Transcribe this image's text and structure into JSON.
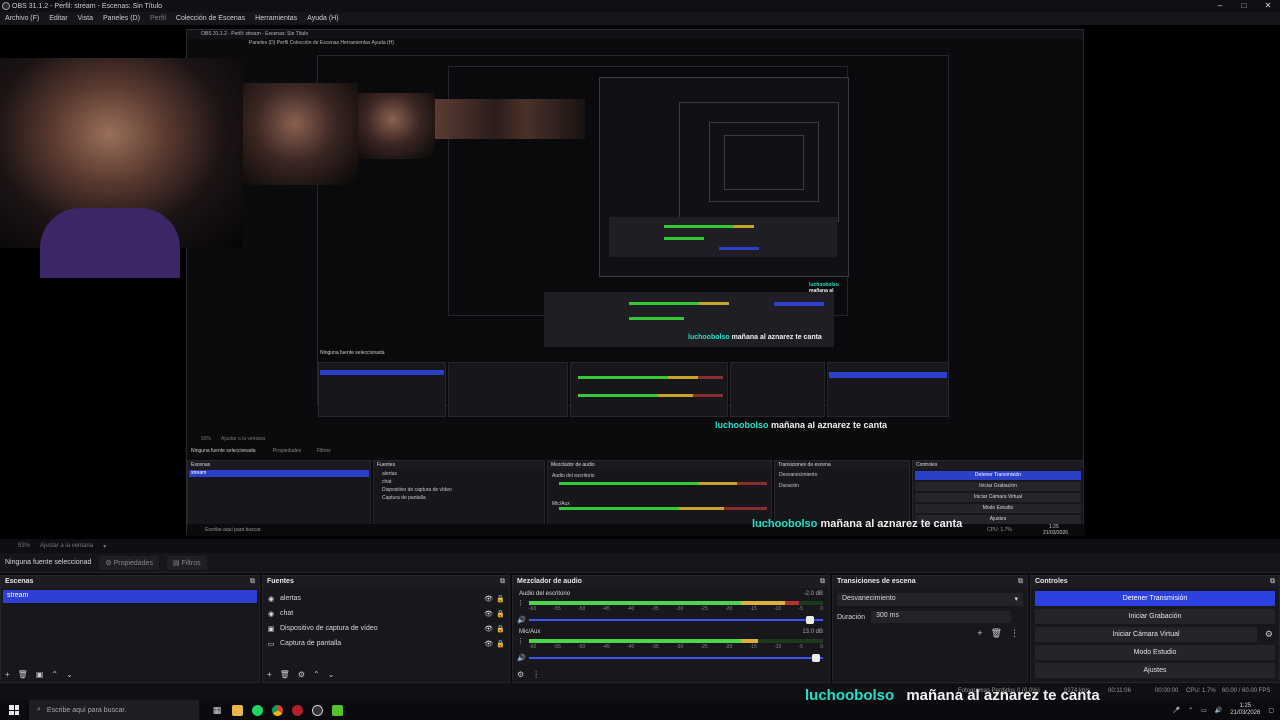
{
  "window": {
    "title": "OBS 31.1.2 - Perfil: stream - Escenas: Sin Título",
    "controls": [
      "–",
      "□",
      "✕"
    ]
  },
  "menu": [
    "Archivo (F)",
    "Editar",
    "Vista",
    "Paneles (D)",
    "Perfil",
    "Colección de Escenas",
    "Herramientas",
    "Ayuda (H)"
  ],
  "nested": {
    "title": "OBS 31.1.2 - Perfil: stream - Escenas: Sin Título",
    "menu": "Paneles (D)   Perfil   Colección de Escenas   Herramientas   Ayuda (H)",
    "zoom": "93%",
    "fit": "Ajustar a la ventana",
    "no_source": "Ninguna fuente seleccionada",
    "props": "Propiedades",
    "filters": "Filtros",
    "scenes_h": "Escenas",
    "sources_h": "Fuentes",
    "mixer_h": "Mezclador de audio",
    "trans_h": "Transiciones de escena",
    "controls_h": "Controles",
    "scene": "stream",
    "sources": [
      "alertas",
      "chat",
      "Dispositivo de captura de vídeo",
      "Captura de pantalla"
    ],
    "mix1": "Audio del escritorio",
    "mix2": "Mic/Aux",
    "transition": "Desvanecimiento",
    "duration_label": "Duración",
    "duration": "300 ms",
    "buttons": [
      "Detener Transmisión",
      "Iniciar Grabación",
      "Iniciar Cámara Virtual",
      "Modo Estudio",
      "Ajustes"
    ],
    "search": "Escribe aquí para buscar.",
    "status": "CPU: 1.7%",
    "clock_time": "1:25",
    "clock_date": "21/03/2026"
  },
  "ticker": {
    "user": "luchoobolso",
    "message": "mañana al aznarez te canta"
  },
  "zoom": {
    "percent": "93%",
    "fit": "Ajustar a la ventana"
  },
  "properties_bar": {
    "selection": "Ninguna fuente seleccionad",
    "properties": "Propiedades",
    "filters": "Filtros"
  },
  "scenes": {
    "title": "Escenas",
    "items": [
      "stream"
    ]
  },
  "sources": {
    "title": "Fuentes",
    "items": [
      {
        "label": "alertas",
        "icon": "globe-icon"
      },
      {
        "label": "chat",
        "icon": "globe-icon"
      },
      {
        "label": "Dispositivo de captura de vídeo",
        "icon": "camera-icon"
      },
      {
        "label": "Captura de pantalla",
        "icon": "monitor-icon"
      }
    ]
  },
  "mixer": {
    "title": "Mezclador de audio",
    "channels": [
      {
        "name": "Audio del escritorio",
        "db": "-2.0 dB",
        "level": 0.92,
        "volume": 0.97
      },
      {
        "name": "Mic/Aux",
        "db": "13.0 dB",
        "level": 0.78,
        "volume": 0.99
      }
    ],
    "scale": [
      "-60",
      "-55",
      "-50",
      "-45",
      "-40",
      "-35",
      "-30",
      "-25",
      "-20",
      "-15",
      "-10",
      "-5",
      "0"
    ]
  },
  "transitions": {
    "title": "Transiciones de escena",
    "selected": "Desvanecimiento",
    "duration_label": "Duración",
    "duration": "300 ms"
  },
  "controls": {
    "title": "Controles",
    "buttons": [
      "Detener Transmisión",
      "Iniciar Grabación",
      "Iniciar Cámara Virtual",
      "Modo Estudio",
      "Ajustes"
    ]
  },
  "status": {
    "dropped": "Fotogramas Perdidos 0 (0.0%)",
    "bitrate": "8274 kb/s",
    "stream_time": "00:11:06",
    "rec_time": "00:00:00",
    "cpu": "CPU: 1.7%",
    "fps": "60.00 / 60.00 FPS"
  },
  "taskbar": {
    "search_placeholder": "Escribe aquí para buscar.",
    "time": "1:25",
    "date": "21/03/2026"
  },
  "colors": {
    "accent": "#2b41e0",
    "ticker_user": "#23e1c8",
    "meter_green": "#4cd64c",
    "meter_yellow": "#dbb13a",
    "meter_red": "#b53131"
  }
}
